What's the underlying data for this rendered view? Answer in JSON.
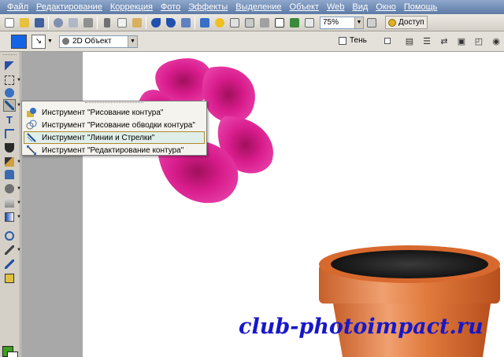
{
  "menu": [
    "Файл",
    "Редактирование",
    "Коррекция",
    "Фото",
    "Эффекты",
    "Выделение",
    "Объект",
    "Web",
    "Вид",
    "Окно",
    "Помощь"
  ],
  "toolbar": {
    "zoom": "75%",
    "access_label": "Доступ"
  },
  "attribute_bar": {
    "color": "#1464e6",
    "object_mode": "2D Объект",
    "shadow_label": "Тень"
  },
  "flyout": {
    "items": [
      "Инструмент \"Рисование контура\"",
      "Инструмент \"Рисование обводки контура\"",
      "Инструмент \"Линии и Стрелки\"",
      "Инструмент \"Редактирование контура\""
    ],
    "selected_index": 2
  },
  "colors": {
    "foreground": "#3ca01e",
    "background": "#ffffff",
    "flower": "#d81c8c",
    "pot": "#e07a3c"
  },
  "watermark": "club-photoimpact.ru"
}
